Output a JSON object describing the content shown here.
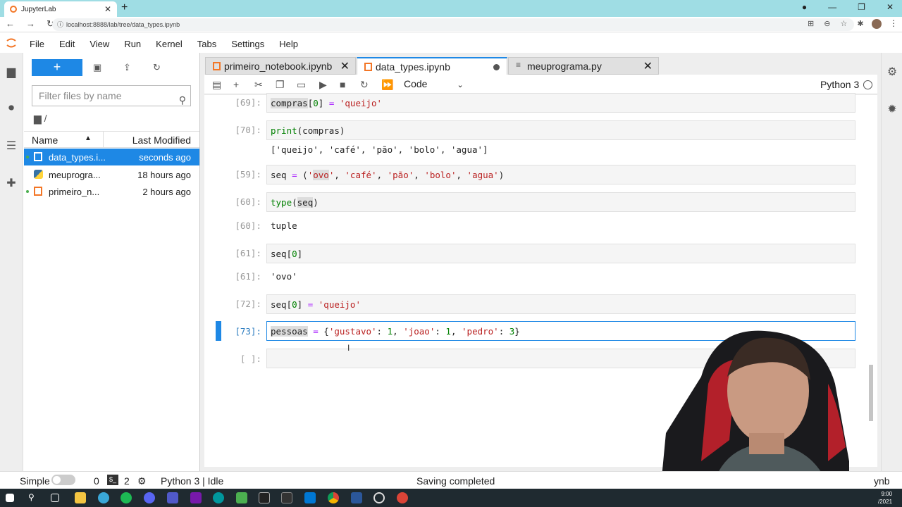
{
  "browser": {
    "tab_title": "JupyterLab",
    "close": "✕",
    "new_tab": "+",
    "url": "localhost:8888/lab/tree/data_types.ipynb"
  },
  "menu": [
    "File",
    "Edit",
    "View",
    "Run",
    "Kernel",
    "Tabs",
    "Settings",
    "Help"
  ],
  "filebrowser": {
    "new_button": "+",
    "filter_placeholder": "Filter files by name",
    "breadcrumb": "/",
    "col_name": "Name",
    "col_modified": "Last Modified",
    "files": [
      {
        "name": "data_types.i...",
        "modified": "seconds ago",
        "type": "notebook",
        "selected": true
      },
      {
        "name": "meuprogra...",
        "modified": "18 hours ago",
        "type": "python",
        "selected": false
      },
      {
        "name": "primeiro_n...",
        "modified": "2 hours ago",
        "type": "notebook",
        "selected": false
      }
    ]
  },
  "tabs": [
    {
      "label": "primeiro_notebook.ipynb",
      "state": "close"
    },
    {
      "label": "data_types.ipynb",
      "state": "dirty"
    },
    {
      "label": "meuprograma.py",
      "state": "close"
    }
  ],
  "toolbar": {
    "cell_type": "Code",
    "kernel": "Python 3"
  },
  "cells": [
    {
      "in": "[69]:",
      "code": "compras[0] = 'queijo'"
    },
    {
      "in": "[70]:",
      "code": "print(compras)",
      "out": "['queijo', 'café', 'pão', 'bolo', 'agua']"
    },
    {
      "in": "[59]:",
      "code": "seq = ('ovo', 'café', 'pão', 'bolo', 'agua')"
    },
    {
      "in": "[60]:",
      "code": "type(seq)",
      "out_prompt": "[60]:",
      "out": "tuple"
    },
    {
      "in": "[61]:",
      "code": "seq[0]",
      "out_prompt": "[61]:",
      "out": "'ovo'"
    },
    {
      "in": "[72]:",
      "code": "seq[0] = 'queijo'"
    },
    {
      "in": "[73]:",
      "code": "pessoas = {'gustavo': 1, 'joao': 1, 'pedro': 3}"
    },
    {
      "in": "[ ]:",
      "code": ""
    }
  ],
  "status": {
    "mode": "Simple",
    "terminals": "0",
    "kernels": "2",
    "kernel_status": "Python 3 | Idle",
    "message": "Saving completed",
    "file_type": "ynb"
  },
  "clock": {
    "time": "9:00",
    "date": "/2021"
  },
  "colors": {
    "accent": "#1e88e5",
    "jupyter_orange": "#f37626",
    "browser_tabstrip": "#9fdde4"
  }
}
